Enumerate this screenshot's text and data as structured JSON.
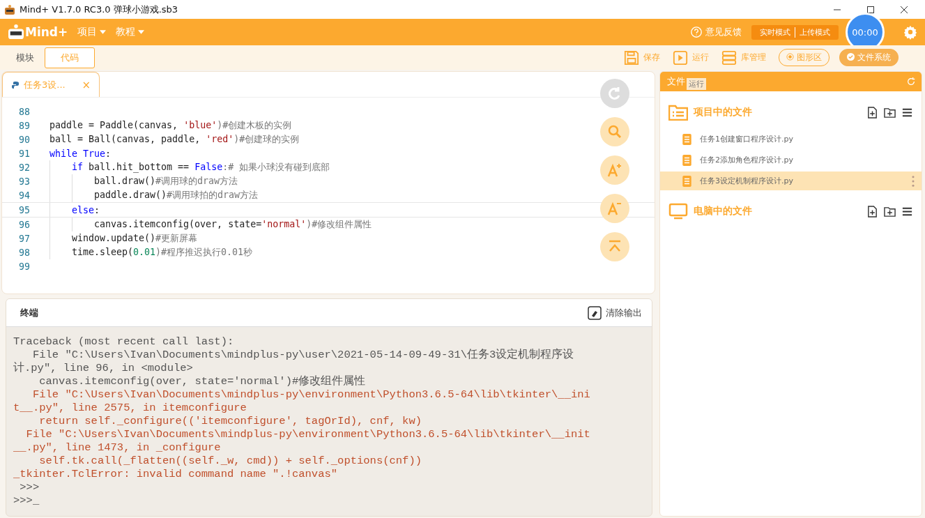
{
  "window": {
    "title": "Mind+ V1.7.0 RC3.0   弹球小游戏.sb3"
  },
  "menu": [
    {
      "label": "项目"
    },
    {
      "label": "教程"
    }
  ],
  "header": {
    "brand": "Mind+",
    "feedback": "意见反馈",
    "modes": [
      {
        "label": "实时模式",
        "selected": false
      },
      {
        "label": "上传模式",
        "selected": false
      }
    ],
    "timer": "00:00"
  },
  "view_tabs": [
    {
      "label": "模块",
      "selected": false
    },
    {
      "label": "代码",
      "selected": true
    }
  ],
  "toolbar": [
    {
      "kind": "save",
      "label": "保存"
    },
    {
      "kind": "run",
      "label": "运行"
    },
    {
      "kind": "library",
      "label": "库管理"
    },
    {
      "kind": "stage",
      "label": "图形区"
    },
    {
      "kind": "files",
      "label": "文件系统"
    }
  ],
  "tooltip": "运行",
  "editor_tabs": [
    {
      "label": "任务3设...",
      "close": "×",
      "selected": true
    }
  ],
  "code": [
    {
      "n": "88",
      "current": false
    },
    {
      "n": "89",
      "current": false,
      "tokens": [
        {
          "text": "paddle = Paddle(canvas, ",
          "kind": "plain"
        },
        {
          "text": "'blue'",
          "kind": "string"
        },
        {
          "text": ")#创建木板的实例",
          "kind": "comment"
        }
      ]
    },
    {
      "n": "90",
      "current": false,
      "tokens": [
        {
          "text": "ball = Ball(canvas, paddle, ",
          "kind": "plain"
        },
        {
          "text": "'red'",
          "kind": "string"
        },
        {
          "text": ")#创建球的实例",
          "kind": "comment"
        }
      ]
    },
    {
      "n": "91",
      "current": false,
      "tokens": [
        {
          "text": "while True",
          "kind": "keyword"
        },
        {
          "text": ":",
          "kind": "plain"
        }
      ]
    },
    {
      "n": "92",
      "current": false,
      "tokens": [
        {
          "text": "    if",
          "kind": "keyword"
        },
        {
          "text": " ball.hit_bottom == ",
          "kind": "plain"
        },
        {
          "text": "False",
          "kind": "keyword"
        },
        {
          "text": ":# 如果小球没有碰到底部",
          "kind": "comment"
        }
      ]
    },
    {
      "n": "93",
      "current": false,
      "tokens": [
        {
          "text": "        ball.draw()",
          "kind": "plain"
        },
        {
          "text": "#调用球的draw方法",
          "kind": "comment"
        }
      ]
    },
    {
      "n": "94",
      "current": false,
      "tokens": [
        {
          "text": "        paddle.draw()",
          "kind": "plain"
        },
        {
          "text": "#调用球拍的draw方法",
          "kind": "comment"
        }
      ]
    },
    {
      "n": "95",
      "current": true,
      "tokens": [
        {
          "text": "    else",
          "kind": "keyword"
        },
        {
          "text": ":",
          "kind": "plain"
        }
      ]
    },
    {
      "n": "96",
      "current": false,
      "tokens": [
        {
          "text": "        canvas.itemconfig(over, state=",
          "kind": "plain"
        },
        {
          "text": "'normal'",
          "kind": "string"
        },
        {
          "text": ")#修改组件属性",
          "kind": "comment"
        }
      ]
    },
    {
      "n": "97",
      "current": false,
      "tokens": [
        {
          "text": "    window.update()",
          "kind": "plain"
        },
        {
          "text": "#更新屏幕",
          "kind": "comment"
        }
      ]
    },
    {
      "n": "98",
      "current": false,
      "tokens": [
        {
          "text": "    time.sleep(",
          "kind": "plain"
        },
        {
          "text": "0.01",
          "kind": "number"
        },
        {
          "text": ")#程序推迟执行0.01秒",
          "kind": "comment"
        }
      ]
    },
    {
      "n": "99",
      "current": false
    }
  ],
  "editor_tools": [
    {
      "kind": "redo",
      "disabled": true
    },
    {
      "kind": "search",
      "disabled": false
    },
    {
      "kind": "font_up",
      "disabled": false
    },
    {
      "kind": "font_down",
      "disabled": false
    },
    {
      "kind": "top",
      "disabled": false
    }
  ],
  "terminal": {
    "title": "终端",
    "clear": "清除输出",
    "lines": [
      {
        "text": "Traceback (most recent call last):",
        "kind": "normal"
      },
      {
        "text": "   File \"C:\\Users\\Ivan\\Documents\\mindplus-py\\user\\2021-05-14-09-49-31\\任务3设定机制程序设",
        "kind": "normal"
      },
      {
        "text": "计.py\", line 96, in <module>",
        "kind": "normal"
      },
      {
        "text": "    canvas.itemconfig(over, state='normal')#修改组件属性",
        "kind": "normal"
      },
      {
        "text": "   File \"C:\\Users\\Ivan\\Documents\\mindplus-py\\environment\\Python3.6.5-64\\lib\\tkinter\\__ini",
        "kind": "error"
      },
      {
        "text": "t__.py\", line 2575, in itemconfigure",
        "kind": "error"
      },
      {
        "text": "    return self._configure(('itemconfigure', tagOrId), cnf, kw)",
        "kind": "error"
      },
      {
        "text": "  File \"C:\\Users\\Ivan\\Documents\\mindplus-py\\environment\\Python3.6.5-64\\lib\\tkinter\\__init",
        "kind": "error"
      },
      {
        "text": "__.py\", line 1473, in _configure",
        "kind": "error"
      },
      {
        "text": "    self.tk.call(_flatten((self._w, cmd)) + self._options(cnf))",
        "kind": "error"
      },
      {
        "text": "_tkinter.TclError: invalid command name \".!canvas\"",
        "kind": "error"
      },
      {
        "text": " >>>",
        "kind": "normal"
      },
      {
        "text": ">>>_",
        "kind": "normal"
      }
    ]
  },
  "files_panel": {
    "title": "文件",
    "sections": [
      {
        "kind": "project",
        "title": "项目中的文件",
        "files": [
          {
            "name": "任务1创建窗口程序设计.py",
            "selected": false
          },
          {
            "name": "任务2添加角色程序设计.py",
            "selected": false
          },
          {
            "name": "任务3设定机制程序设计.py",
            "selected": true
          }
        ]
      },
      {
        "kind": "computer",
        "title": "电脑中的文件"
      }
    ]
  }
}
